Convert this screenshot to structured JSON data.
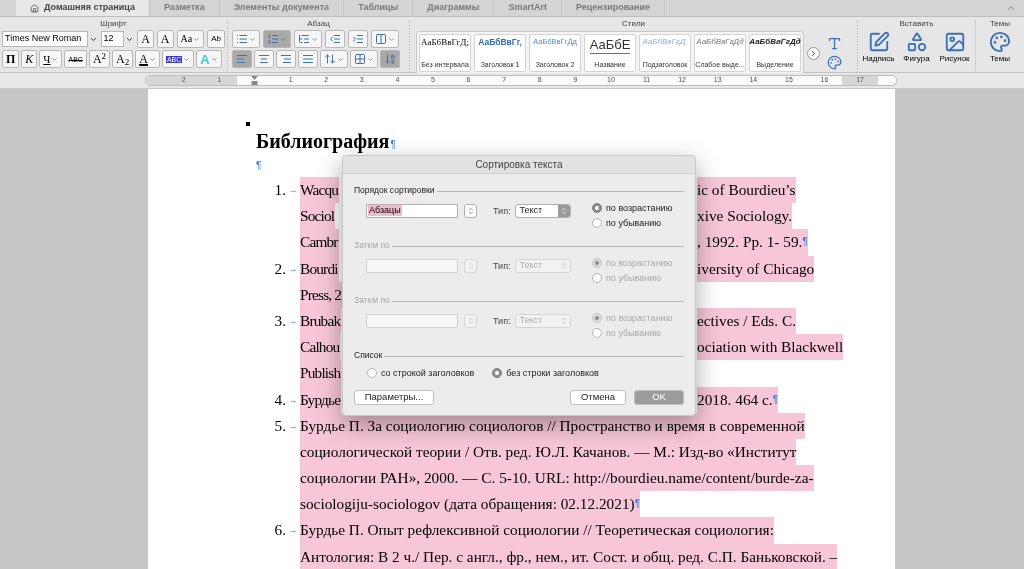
{
  "tabs": [
    {
      "label": "Домашняя страница",
      "selected": true
    },
    {
      "label": "Разметка",
      "selected": false
    },
    {
      "label": "Элементы документа",
      "selected": false
    },
    {
      "label": "Таблицы",
      "selected": false
    },
    {
      "label": "Диаграммы",
      "selected": false
    },
    {
      "label": "SmartArt",
      "selected": false
    },
    {
      "label": "Рецензирование",
      "selected": false
    }
  ],
  "font_group": {
    "label": "Шрифт",
    "font_name": "Times New Roman",
    "font_size": "12",
    "row1": [
      {
        "kind": "grow",
        "glyph": "A"
      },
      {
        "kind": "shrink",
        "glyph": "A"
      },
      {
        "kind": "case",
        "glyph": "Aa"
      },
      {
        "kind": "clear",
        "glyph": "Ab"
      }
    ],
    "row2": [
      {
        "kind": "bold",
        "glyph": "П"
      },
      {
        "kind": "italic",
        "glyph": "К"
      },
      {
        "kind": "underline",
        "glyph": "Ч"
      },
      {
        "kind": "strike",
        "glyph": "ABC"
      },
      {
        "kind": "sup",
        "glyph": "A$^{2}$"
      },
      {
        "kind": "sub",
        "glyph": "A$_{2}$"
      },
      {
        "kind": "color",
        "glyph": "A"
      },
      {
        "kind": "highlight",
        "glyph": "ABC"
      },
      {
        "kind": "effects",
        "glyph": "A"
      }
    ]
  },
  "paragraph_group": {
    "label": "Абзац",
    "row1": [
      {
        "kind": "bullets",
        "selected": false
      },
      {
        "kind": "numbering",
        "selected": true
      },
      {
        "kind": "multilevel",
        "selected": false
      },
      {
        "kind": "outdent",
        "selected": false
      },
      {
        "kind": "indent",
        "selected": false
      },
      {
        "kind": "columns",
        "selected": false
      }
    ],
    "row2": [
      {
        "kind": "left",
        "selected": true
      },
      {
        "kind": "center",
        "selected": false
      },
      {
        "kind": "right",
        "selected": false
      },
      {
        "kind": "justify",
        "selected": false
      },
      {
        "kind": "spacing",
        "selected": false
      },
      {
        "kind": "borders",
        "selected": false
      },
      {
        "kind": "sort",
        "selected": true
      }
    ]
  },
  "styles_group": {
    "label": "Стили",
    "styles": [
      {
        "kind": "plain",
        "sample": "АаБбВвГгД;",
        "name": "Без интервала"
      },
      {
        "kind": "heading1",
        "sample": "АаБбВвГг,",
        "name": "Заголовок 1"
      },
      {
        "kind": "heading2",
        "sample": "АаБбВвГгДд",
        "name": "Заголовок 2"
      },
      {
        "kind": "title",
        "sample": "АаБбЕ",
        "name": "Название"
      },
      {
        "kind": "subtitle",
        "sample": "АаБбВвГгД,",
        "name": "Подзаголовок"
      },
      {
        "kind": "subtle",
        "sample": "АаБбВвГгДд",
        "name": "Слабое выде..."
      },
      {
        "kind": "emphasis",
        "sample": "АаБбВвГгДд",
        "name": "Выделение"
      }
    ]
  },
  "insert_group": {
    "label": "Вставить",
    "items": [
      {
        "kind": "textbox",
        "label": "Надпись"
      },
      {
        "kind": "shape",
        "label": "Фигура"
      },
      {
        "kind": "picture",
        "label": "Рисунок"
      }
    ]
  },
  "themes_group": {
    "label": "Темы",
    "button": "Темы"
  },
  "ruler": {
    "left_labels": [
      "2",
      "1"
    ],
    "right_labels": [
      "1",
      "2",
      "3",
      "4",
      "5",
      "6",
      "7",
      "8",
      "9",
      "10",
      "11",
      "12",
      "13",
      "14",
      "15",
      "16",
      "17"
    ]
  },
  "document": {
    "heading": "Библиография",
    "heading_mark": "¶",
    "empty_mark": "¶",
    "tab_mark": "→",
    "items": [
      {
        "number": "1.",
        "end_mark": "¶",
        "lines": [
          {
            "left": "Wacqu",
            "right": "ic of Bourdieu’s"
          },
          {
            "left": "Sociol",
            "right": "xive Sociology."
          },
          {
            "left": "Cambr",
            "right": ", 1992. Pp. 1- 59."
          }
        ]
      },
      {
        "number": "2.",
        "lines": [
          {
            "left": "Bourdi",
            "right": "iversity of Chicago"
          },
          {
            "left": "Press, 2"
          }
        ]
      },
      {
        "number": "3.",
        "lines": [
          {
            "left": "Brubak",
            "right": "ectives / Eds. C."
          },
          {
            "left": "Calhou",
            "right": "ociation with Blackwell"
          },
          {
            "left": "Publish"
          }
        ]
      },
      {
        "number": "4.",
        "end_mark": "¶",
        "lines": [
          {
            "left": "Бурдье",
            "right": "2018. 464 с."
          }
        ]
      },
      {
        "number": "5.",
        "end_mark": "¶",
        "lines": [
          {
            "left": "Бурдье П. За социологию социологов // Пространство и время в современной"
          },
          {
            "left": "социологической теории / Отв. ред. Ю.Л. Качанов. — М.: Изд-во «Институт"
          },
          {
            "left": "социологии РАН», 2000. — С. 5-10. URL: http://bourdieu.name/content/burde-za-"
          },
          {
            "left": "sociologiju-sociologov (дата обращения: 02.12.2021)"
          }
        ]
      },
      {
        "number": "6.",
        "lines": [
          {
            "left": "Бурдье П. Опыт рефлексивной социологии // Теоретическая социология:"
          },
          {
            "left": "Антология: В 2 ч./ Пер. с англ., фр., нем., ит. Сост. и общ. ред. С.П. Баньковской. –"
          }
        ]
      }
    ]
  },
  "dialog": {
    "title": "Сортировка текста",
    "sections": [
      {
        "label": "Порядок сортировки",
        "disabled": false,
        "field": "Абзацы",
        "type_label": "Тип:",
        "type_value": "Текст",
        "options": [
          {
            "label": "по возрастанию",
            "selected": true
          },
          {
            "label": "по убыванию",
            "selected": false
          }
        ]
      },
      {
        "label": "Затем по",
        "disabled": true,
        "type_label": "Тип:",
        "type_value": "Текст",
        "options": [
          {
            "label": "по возрастанию",
            "selected": true
          },
          {
            "label": "по убыванию",
            "selected": false
          }
        ]
      },
      {
        "label": "Затем по",
        "disabled": true,
        "type_label": "Тип:",
        "type_value": "Текст",
        "options": [
          {
            "label": "по возрастанию",
            "selected": true
          },
          {
            "label": "по убыванию",
            "selected": false
          }
        ]
      }
    ],
    "list": {
      "label": "Список",
      "options": [
        {
          "label": "со строкой заголовков",
          "selected": false
        },
        {
          "label": "без строки заголовков",
          "selected": true
        }
      ]
    },
    "buttons": [
      {
        "kind": "options",
        "label": "Параметры..."
      },
      {
        "kind": "cancel",
        "label": "Отмена"
      },
      {
        "kind": "default",
        "label": "OK"
      }
    ]
  }
}
